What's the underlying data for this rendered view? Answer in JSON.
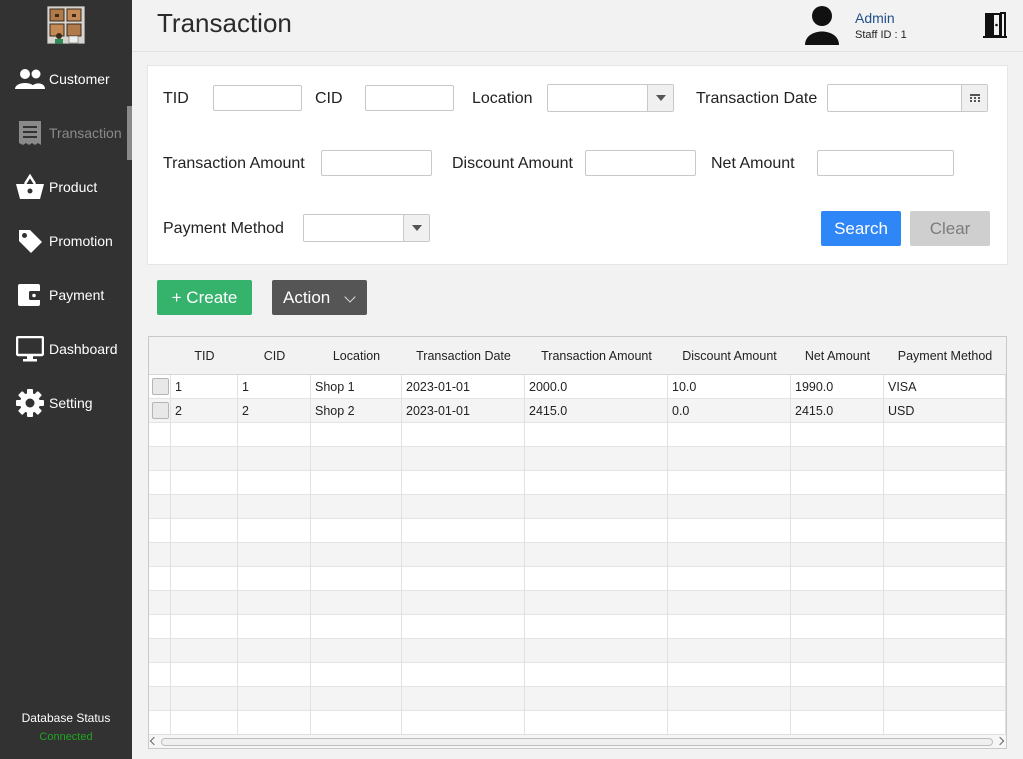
{
  "header": {
    "title": "Transaction",
    "user_name": "Admin",
    "staff_id": "Staff ID : 1"
  },
  "sidebar": {
    "items": [
      {
        "label": "Customer",
        "icon": "people-icon",
        "active": false
      },
      {
        "label": "Transaction",
        "icon": "receipt-icon",
        "active": true
      },
      {
        "label": "Product",
        "icon": "basket-icon",
        "active": false
      },
      {
        "label": "Promotion",
        "icon": "tag-icon",
        "active": false
      },
      {
        "label": "Payment",
        "icon": "wallet-icon",
        "active": false
      },
      {
        "label": "Dashboard",
        "icon": "monitor-icon",
        "active": false
      },
      {
        "label": "Setting",
        "icon": "gear-icon",
        "active": false
      }
    ],
    "db_status_label": "Database Status",
    "db_status_value": "Connected"
  },
  "filters": {
    "tid_label": "TID",
    "tid_value": "",
    "cid_label": "CID",
    "cid_value": "",
    "location_label": "Location",
    "location_value": "",
    "date_label": "Transaction Date",
    "date_value": "",
    "amount_label": "Transaction Amount",
    "amount_value": "",
    "discount_label": "Discount Amount",
    "discount_value": "",
    "net_label": "Net Amount",
    "net_value": "",
    "payment_label": "Payment Method",
    "payment_value": "",
    "search_label": "Search",
    "clear_label": "Clear"
  },
  "actions": {
    "create_label": "+ Create",
    "action_label": "Action"
  },
  "table": {
    "columns": [
      "TID",
      "CID",
      "Location",
      "Transaction Date",
      "Transaction Amount",
      "Discount Amount",
      "Net Amount",
      "Payment Method"
    ],
    "rows": [
      [
        "1",
        "1",
        "Shop 1",
        "2023-01-01",
        "2000.0",
        "10.0",
        "1990.0",
        "VISA"
      ],
      [
        "2",
        "2",
        "Shop 2",
        "2023-01-01",
        "2415.0",
        "0.0",
        "2415.0",
        "USD"
      ]
    ]
  },
  "colors": {
    "sidebar": "#323232",
    "primary": "#2f86f6",
    "success": "#35b26b",
    "connected": "#1fa51f",
    "user_link": "#1f4f8b"
  }
}
